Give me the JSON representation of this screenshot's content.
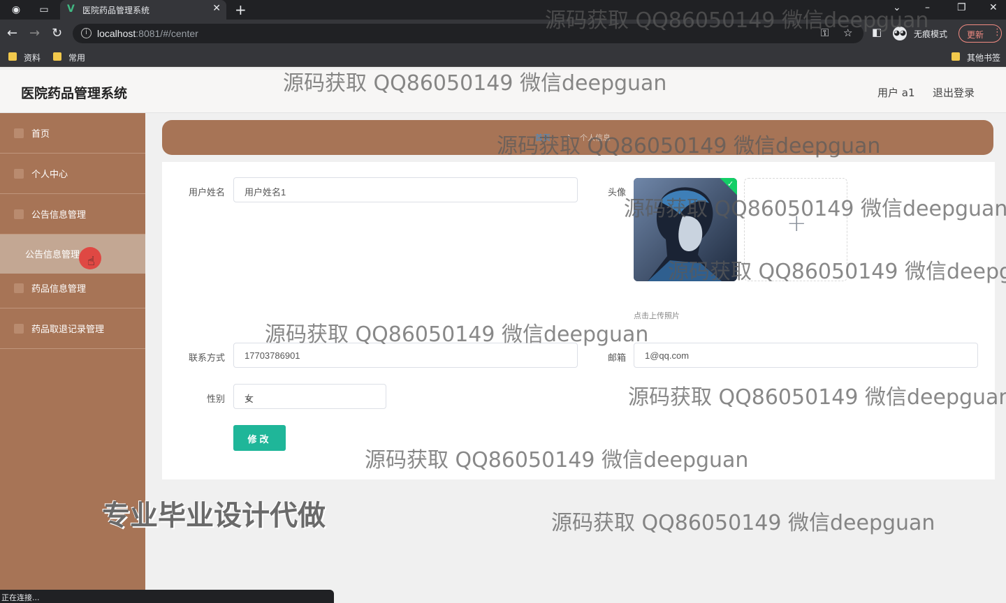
{
  "browser": {
    "tab_title": "医院药品管理系统",
    "url_host": "localhost",
    "url_rest": ":8081/#/center",
    "incognito_label": "无痕模式",
    "update_label": "更新",
    "bookmarks": [
      "资料",
      "常用"
    ],
    "other_bookmarks": "其他书签",
    "status_text": "正在连接..."
  },
  "header": {
    "title": "医院药品管理系统",
    "user": "用户 a1",
    "logout": "退出登录"
  },
  "sidebar": {
    "items": [
      "首页",
      "个人中心",
      "公告信息管理",
      "药品信息管理",
      "药品取退记录管理"
    ],
    "active_sub": "公告信息管理"
  },
  "breadcrumb": {
    "home": "首页",
    "current": "个人信息"
  },
  "form": {
    "name_label": "用户姓名",
    "name_value": "用户姓名1",
    "avatar_label": "头像",
    "upload_hint": "点击上传照片",
    "phone_label": "联系方式",
    "phone_value": "17703786901",
    "email_label": "邮箱",
    "email_value": "1@qq.com",
    "gender_label": "性别",
    "gender_value": "女",
    "submit_label": "修改"
  },
  "overlay": {
    "watermark": "源码获取 QQ86050149 微信deepguan",
    "watermark_cut": "源码获取 QQ86050149 微信deepg",
    "promo": "专业毕业设计代做"
  },
  "colors": {
    "sidebar": "#a77456",
    "accent_button": "#1fb699"
  }
}
